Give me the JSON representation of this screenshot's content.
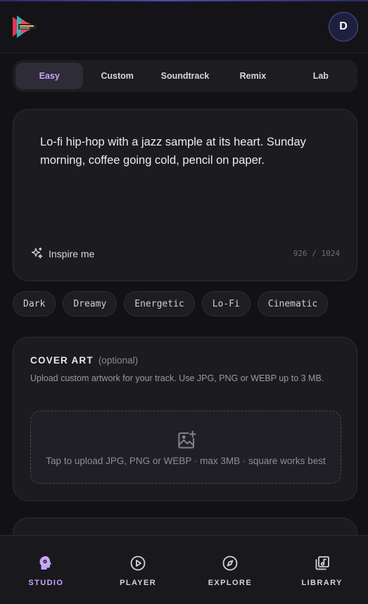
{
  "app": {
    "avatar_initial": "D",
    "accent_color": "#c8a6ff"
  },
  "tabs": [
    {
      "label": "Easy",
      "active": true
    },
    {
      "label": "Custom",
      "active": false
    },
    {
      "label": "Soundtrack",
      "active": false
    },
    {
      "label": "Remix",
      "active": false
    },
    {
      "label": "Lab",
      "active": false
    }
  ],
  "prompt": {
    "text": "Lo-fi hip-hop with a jazz sample at its heart. Sunday morning, coffee going cold, pencil on paper.",
    "inspire_label": "Inspire me",
    "counter": "926 / 1024"
  },
  "moods": [
    "Dark",
    "Dreamy",
    "Energetic",
    "Lo-Fi",
    "Cinematic"
  ],
  "cover_art": {
    "title": "COVER ART",
    "optional": "(optional)",
    "description": "Upload custom artwork for your track. Use JPG, PNG or WEBP up to 3 MB.",
    "dropzone_text": "Tap to upload JPG, PNG or WEBP · max 3MB · square works best"
  },
  "nav": [
    {
      "label": "STUDIO",
      "icon": "studio-icon",
      "active": true
    },
    {
      "label": "PLAYER",
      "icon": "play-circle-icon",
      "active": false
    },
    {
      "label": "EXPLORE",
      "icon": "compass-icon",
      "active": false
    },
    {
      "label": "LIBRARY",
      "icon": "library-icon",
      "active": false
    }
  ]
}
